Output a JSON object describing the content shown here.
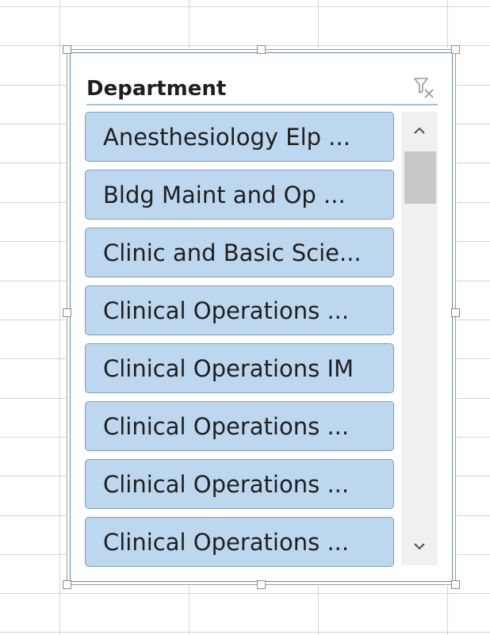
{
  "slicer": {
    "title": "Department",
    "icons": {
      "clear_filter": "clear-filter-icon",
      "scroll_up": "chevron-up-icon",
      "scroll_down": "chevron-down-icon"
    },
    "items": [
      {
        "label": "Anesthesiology Elp ..."
      },
      {
        "label": "Bldg Maint and Op ..."
      },
      {
        "label": "Clinic and Basic Scie..."
      },
      {
        "label": "Clinical Operations ..."
      },
      {
        "label": "Clinical Operations IM"
      },
      {
        "label": "Clinical Operations ..."
      },
      {
        "label": "Clinical Operations ..."
      },
      {
        "label": "Clinical Operations ..."
      }
    ],
    "colors": {
      "item_fill": "#bdd7ee",
      "item_border": "#7f9fc0",
      "header_rule": "#9dc3e6",
      "frame": "#5b86b5"
    }
  }
}
